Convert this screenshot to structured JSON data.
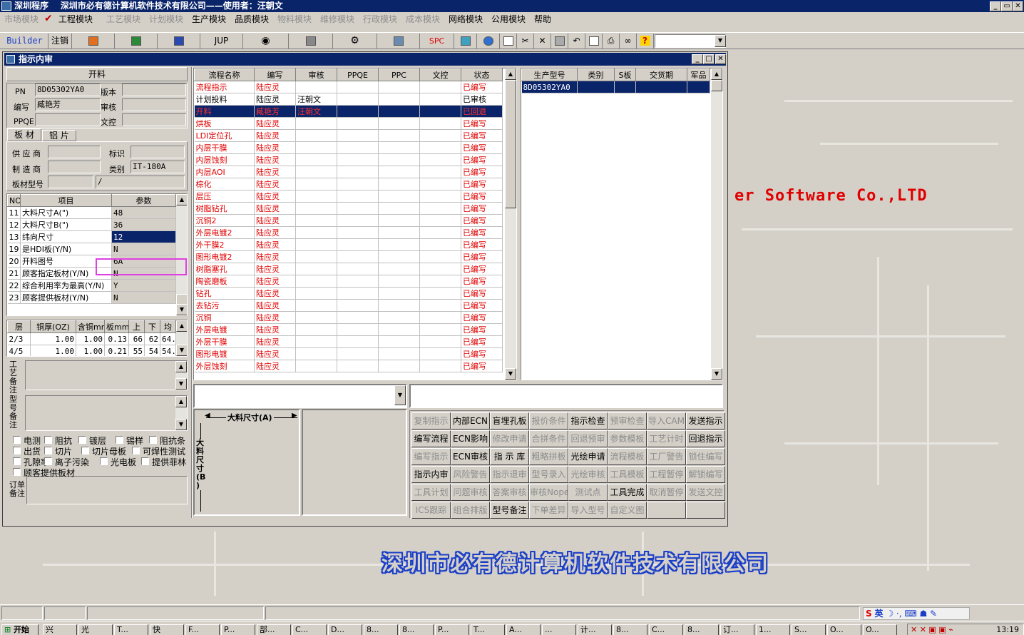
{
  "app": {
    "title": "深圳程序    深圳市必有德计算机软件技术有限公司——使用者：汪朝文"
  },
  "menu": [
    {
      "label": "市场模块",
      "enabled": false
    },
    {
      "label": "工程模块",
      "enabled": true
    },
    {
      "label": "工艺模块",
      "enabled": false
    },
    {
      "label": "计划模块",
      "enabled": false
    },
    {
      "label": "生产模块",
      "enabled": true
    },
    {
      "label": "品质模块",
      "enabled": true
    },
    {
      "label": "物料模块",
      "enabled": false
    },
    {
      "label": "维修模块",
      "enabled": false
    },
    {
      "label": "行政模块",
      "enabled": false
    },
    {
      "label": "成本模块",
      "enabled": false
    },
    {
      "label": "网络模块",
      "enabled": true
    },
    {
      "label": "公用模块",
      "enabled": true
    },
    {
      "label": "帮助",
      "enabled": true
    }
  ],
  "toolbar": {
    "builder": "Builder",
    "logout": "注销",
    "jup": "JUP",
    "spc": "SPC"
  },
  "window": {
    "title": "指示内审"
  },
  "left": {
    "section_title": "开料",
    "pn_label": "PN",
    "pn_value": "8D05302YA0",
    "version_label": "版本",
    "version_value": "",
    "author_label": "编写",
    "author_value": "臧艳芳",
    "review_label": "审核",
    "review_value": "",
    "pqe_label": "PPQE",
    "pqe_value": "",
    "doc_label": "文控",
    "doc_value": "",
    "tab1": "板 材",
    "tab2": "铝 片",
    "supplier_label": "供 应 商",
    "supplier_value": "",
    "mark_label": "标识",
    "mark_value": "",
    "maker_label": "制 造 商",
    "maker_value": "",
    "type_label": "类别",
    "type_value": "IT-180A",
    "board_label": "板材型号",
    "board_value1": "",
    "board_value2": "/",
    "params_headers": [
      "NO",
      "项目",
      "参数"
    ],
    "params": [
      [
        "11",
        "大料尺寸A(\")",
        "48"
      ],
      [
        "12",
        "大料尺寸B(\")",
        "36"
      ],
      [
        "13",
        "纬向尺寸",
        "12"
      ],
      [
        "19",
        "是HDI板(Y/N)",
        "N"
      ],
      [
        "20",
        "开料图号",
        "6A"
      ],
      [
        "21",
        "顾客指定板材(Y/N)",
        "N"
      ],
      [
        "22",
        "综合利用率为最高(Y/N)",
        "Y"
      ],
      [
        "23",
        "顾客提供板材(Y/N)",
        "N"
      ]
    ],
    "layer_headers": [
      "层",
      "铜厚(OZ)",
      "含铜mm",
      "板mm",
      "上",
      "下",
      "均"
    ],
    "layers": [
      [
        "2/3",
        "1.00",
        "1.00",
        "0.13",
        "66",
        "62",
        "64."
      ],
      [
        "4/5",
        "1.00",
        "1.00",
        "0.21",
        "55",
        "54",
        "54."
      ]
    ],
    "note1_label": "工艺备注",
    "note2_label": "型号备注",
    "note3_label": "订单备注",
    "checks": [
      [
        "电测",
        "阻抗",
        "镀层",
        "锡样",
        "阻抗条"
      ],
      [
        "出货",
        "切片",
        "切片母板",
        "可焊性测试"
      ],
      [
        "孔隙率",
        "离子污染",
        "光电板",
        "提供菲林"
      ],
      [
        "顾客提供板材"
      ]
    ]
  },
  "flow": {
    "headers": [
      "流程名称",
      "编写",
      "审核",
      "PPQE",
      "PPC",
      "文控",
      "状态"
    ],
    "rows": [
      {
        "name": "流程指示",
        "author": "陆应灵",
        "reviewer": "",
        "status": "已编写",
        "red": true
      },
      {
        "name": "计划投料",
        "author": "陆应灵",
        "reviewer": "汪朝文",
        "status": "已审核",
        "red": false
      },
      {
        "name": "开料",
        "author": "臧艳芳",
        "reviewer": "汪朝文",
        "status": "已回退",
        "red": true,
        "selected": true
      },
      {
        "name": "烘板",
        "author": "陆应灵",
        "reviewer": "",
        "status": "已编写",
        "red": true
      },
      {
        "name": "LDI定位孔",
        "author": "陆应灵",
        "reviewer": "",
        "status": "已编写",
        "red": true
      },
      {
        "name": "内层干膜",
        "author": "陆应灵",
        "reviewer": "",
        "status": "已编写",
        "red": true
      },
      {
        "name": "内层蚀刻",
        "author": "陆应灵",
        "reviewer": "",
        "status": "已编写",
        "red": true
      },
      {
        "name": "内层AOI",
        "author": "陆应灵",
        "reviewer": "",
        "status": "已编写",
        "red": true
      },
      {
        "name": "棕化",
        "author": "陆应灵",
        "reviewer": "",
        "status": "已编写",
        "red": true
      },
      {
        "name": "层压",
        "author": "陆应灵",
        "reviewer": "",
        "status": "已编写",
        "red": true
      },
      {
        "name": "树脂钻孔",
        "author": "陆应灵",
        "reviewer": "",
        "status": "已编写",
        "red": true
      },
      {
        "name": "沉铜2",
        "author": "陆应灵",
        "reviewer": "",
        "status": "已编写",
        "red": true
      },
      {
        "name": "外层电镀2",
        "author": "陆应灵",
        "reviewer": "",
        "status": "已编写",
        "red": true
      },
      {
        "name": "外干膜2",
        "author": "陆应灵",
        "reviewer": "",
        "status": "已编写",
        "red": true
      },
      {
        "name": "图形电镀2",
        "author": "陆应灵",
        "reviewer": "",
        "status": "已编写",
        "red": true
      },
      {
        "name": "树脂塞孔",
        "author": "陆应灵",
        "reviewer": "",
        "status": "已编写",
        "red": true
      },
      {
        "name": "陶瓷磨板",
        "author": "陆应灵",
        "reviewer": "",
        "status": "已编写",
        "red": true
      },
      {
        "name": "钻孔",
        "author": "陆应灵",
        "reviewer": "",
        "status": "已编写",
        "red": true
      },
      {
        "name": "去钻污",
        "author": "陆应灵",
        "reviewer": "",
        "status": "已编写",
        "red": true
      },
      {
        "name": "沉铜",
        "author": "陆应灵",
        "reviewer": "",
        "status": "已编写",
        "red": true
      },
      {
        "name": "外层电镀",
        "author": "陆应灵",
        "reviewer": "",
        "status": "已编写",
        "red": true
      },
      {
        "name": "外层干膜",
        "author": "陆应灵",
        "reviewer": "",
        "status": "已编写",
        "red": true
      },
      {
        "name": "图形电镀",
        "author": "陆应灵",
        "reviewer": "",
        "status": "已编写",
        "red": true
      },
      {
        "name": "外层蚀刻",
        "author": "陆应灵",
        "reviewer": "",
        "status": "已编写",
        "red": true
      }
    ]
  },
  "orders": {
    "headers": [
      "生产型号",
      "类别",
      "S板",
      "交货期",
      "军品"
    ],
    "rows": [
      [
        "8D05302YA0",
        "",
        "",
        "",
        ""
      ]
    ]
  },
  "drawing": {
    "a_label": "大料尺寸(A)",
    "b_label": "大料尺寸(B)"
  },
  "actions": [
    [
      [
        "复制指示",
        false
      ],
      [
        "内部ECN",
        true
      ],
      [
        "盲埋孔板",
        true
      ],
      [
        "报价条件",
        false
      ],
      [
        "指示检查",
        true
      ],
      [
        "预审检查",
        false
      ],
      [
        "导入CAM",
        false
      ],
      [
        "发送指示",
        true
      ]
    ],
    [
      [
        "编写流程",
        true
      ],
      [
        "ECN影响",
        true
      ],
      [
        "修改申请",
        false
      ],
      [
        "合拼条件",
        false
      ],
      [
        "回退预审",
        false
      ],
      [
        "参数模板",
        false
      ],
      [
        "工艺计时",
        false
      ],
      [
        "回退指示",
        true
      ]
    ],
    [
      [
        "编写指示",
        false
      ],
      [
        "ECN审核",
        true
      ],
      [
        "指 示 库",
        true
      ],
      [
        "粗略拼板",
        false
      ],
      [
        "光绘申请",
        true
      ],
      [
        "流程模板",
        false
      ],
      [
        "工厂警告",
        false
      ],
      [
        "锁住编写",
        false
      ]
    ],
    [
      [
        "指示内审",
        true
      ],
      [
        "风险警告",
        false
      ],
      [
        "指示退审",
        false
      ],
      [
        "型号录入",
        false
      ],
      [
        "光绘审核",
        false
      ],
      [
        "工具模板",
        false
      ],
      [
        "工程暂停",
        false
      ],
      [
        "解锁编写",
        false
      ]
    ],
    [
      [
        "工具计划",
        false
      ],
      [
        "问题审核",
        false
      ],
      [
        "答案审核",
        false
      ],
      [
        "审核Nope",
        false
      ],
      [
        "测试点",
        false
      ],
      [
        "工具完成",
        true
      ],
      [
        "取消暂停",
        false
      ],
      [
        "发送文控",
        false
      ]
    ],
    [
      [
        "ICS跟踪",
        false
      ],
      [
        "组合排版",
        false
      ],
      [
        "型号备注",
        true
      ],
      [
        "下单差异",
        false
      ],
      [
        "导入型号",
        false
      ],
      [
        "自定义图",
        false
      ],
      [
        "",
        false
      ],
      [
        "",
        false
      ]
    ]
  ],
  "background": {
    "company_en": "er Software Co.,LTD",
    "company_cn": "深圳市必有德计算机软件技术有限公司"
  },
  "taskbar": {
    "start": "开始",
    "clock": "13:19",
    "ime": "英",
    "tasks": [
      "兴",
      "光",
      "T...",
      "快",
      "F...",
      "P...",
      "部...",
      "C...",
      "D...",
      "8...",
      "8...",
      "P...",
      "T...",
      "A...",
      "...",
      "计...",
      "8...",
      "C...",
      "8...",
      "订...",
      "1...",
      "S...",
      "O...",
      "O..."
    ]
  }
}
